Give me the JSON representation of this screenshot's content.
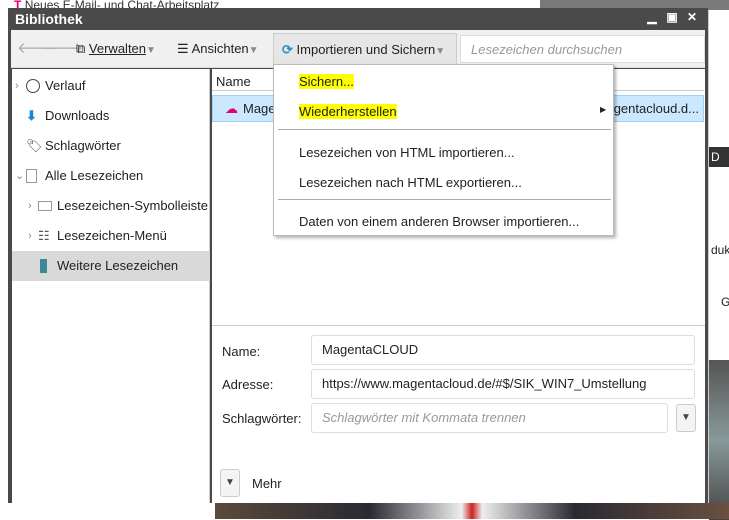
{
  "background": {
    "tab_text": "Neues E-Mail- und Chat-Arbeitsplatz",
    "right_fragments": [
      "D",
      "duk",
      "G"
    ]
  },
  "window": {
    "title": "Bibliothek",
    "controls": [
      "minimize",
      "maximize",
      "close"
    ]
  },
  "toolbar": {
    "manage": "Verwalten",
    "views": "Ansichten",
    "import_backup": "Importieren und Sichern",
    "search_placeholder": "Lesezeichen durchsuchen"
  },
  "sidebar": {
    "items": [
      {
        "label": "Verlauf",
        "icon": "clock-icon"
      },
      {
        "label": "Downloads",
        "icon": "download-icon"
      },
      {
        "label": "Schlagwörter",
        "icon": "tag-icon"
      },
      {
        "label": "Alle Lesezeichen",
        "icon": "bookmarks-icon"
      },
      {
        "label": "Lesezeichen-Symbolleiste",
        "icon": "toolbar-icon"
      },
      {
        "label": "Lesezeichen-Menü",
        "icon": "menu-icon"
      },
      {
        "label": "Weitere Lesezeichen",
        "icon": "bookmark-icon",
        "selected": true
      }
    ]
  },
  "list": {
    "column_name": "Name",
    "row": {
      "name": "MagentaCLOUD",
      "location": "https://www.magentacloud.d..."
    }
  },
  "menu": {
    "items": [
      {
        "label": "Sichern...",
        "highlighted": true
      },
      {
        "label": "Wiederherstellen",
        "highlighted": true,
        "submenu": true
      },
      {
        "label": "Lesezeichen von HTML importieren..."
      },
      {
        "label": "Lesezeichen nach HTML exportieren..."
      },
      {
        "label": "Daten von einem anderen Browser importieren..."
      }
    ]
  },
  "details": {
    "name_label": "Name:",
    "name_value": "MagentaCLOUD",
    "address_label": "Adresse:",
    "address_value": "https://www.magentacloud.de/#$/SIK_WIN7_Umstellung",
    "tags_label": "Schlagwörter:",
    "tags_placeholder": "Schlagwörter mit Kommata trennen",
    "more": "Mehr"
  },
  "colors": {
    "titlebar": "#4a4a4a",
    "highlight": "#ffff00",
    "selection": "#cce8ff",
    "brand": "#e20074"
  }
}
